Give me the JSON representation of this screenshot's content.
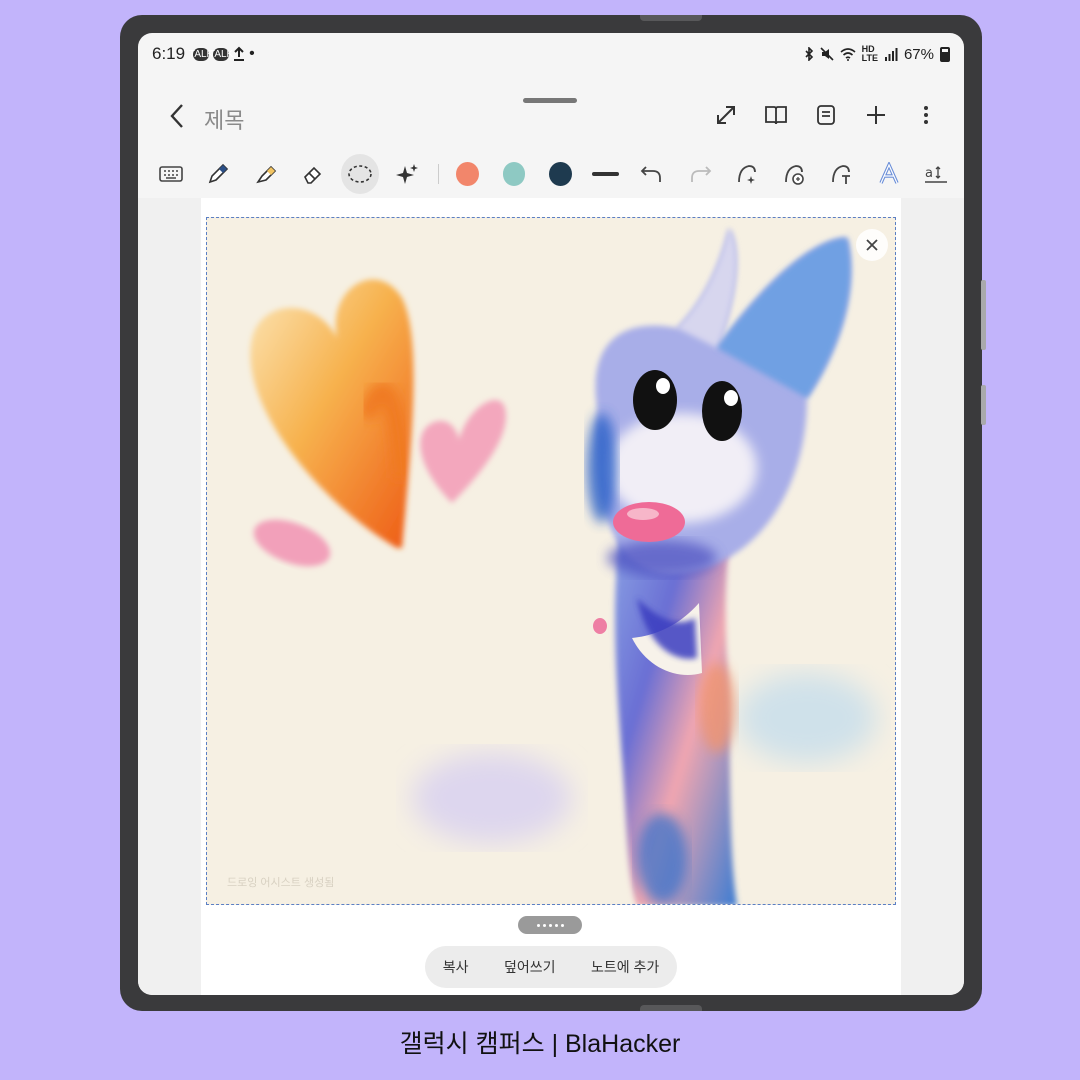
{
  "status_bar": {
    "time": "6:19",
    "notification_icons": [
      "talk-icon",
      "talk-icon",
      "upload-icon"
    ],
    "battery": "67%",
    "icons": [
      "bluetooth-icon",
      "mute-icon",
      "wifi-icon",
      "hd-icon",
      "signal-icon",
      "battery-icon"
    ]
  },
  "header": {
    "title": "제목",
    "actions": [
      "expand-icon",
      "book-icon",
      "page-icon",
      "add-icon",
      "more-icon"
    ]
  },
  "toolbar": {
    "tools": [
      "keyboard-icon",
      "pen-icon",
      "highlighter-icon",
      "eraser-icon",
      "lasso-icon",
      "ai-sparkle-icon"
    ],
    "colors": [
      "#f2866b",
      "#8ec9c3",
      "#1e3a4f"
    ],
    "extra": [
      "undo-icon",
      "redo-icon",
      "shape-assist-icon",
      "ai-text-icon",
      "text-convert-icon",
      "text-style-icon",
      "text-size-icon"
    ]
  },
  "canvas": {
    "watermark": "드로잉 어시스트 생성됨"
  },
  "action_bar": {
    "copy": "복사",
    "overwrite": "덮어쓰기",
    "add_to_note": "노트에 추가"
  },
  "caption": "갤럭시 캠퍼스 | BlaHacker"
}
